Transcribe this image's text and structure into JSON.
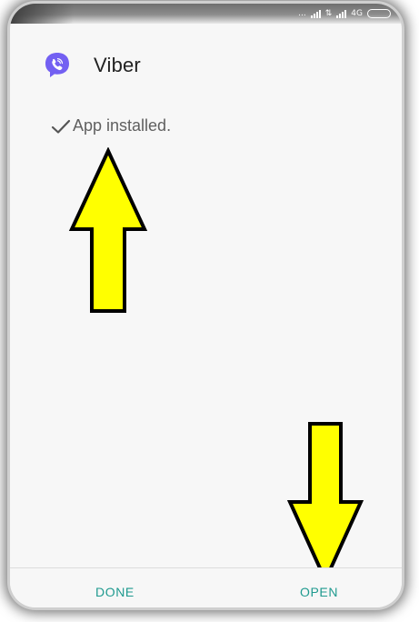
{
  "status_bar": {
    "dots": "...",
    "network_type": "4G"
  },
  "app": {
    "name": "Viber",
    "icon": "viber-logo-icon",
    "brand_color": "#7360f2"
  },
  "status": {
    "message": "App installed.",
    "icon": "check-icon"
  },
  "annotations": {
    "arrow_color": "#ffff00",
    "arrow_outline": "#000000"
  },
  "actions": {
    "done_label": "DONE",
    "open_label": "OPEN",
    "accent": "#1f9a8f"
  }
}
